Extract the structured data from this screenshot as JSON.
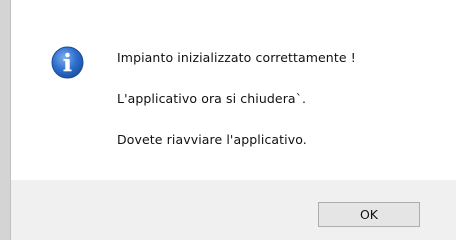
{
  "dialog": {
    "icon": "info-icon",
    "messages": [
      "Impianto inizializzato correttamente !",
      "L'applicativo ora si chiudera`.",
      "Dovete riavviare l'applicativo."
    ],
    "ok_label": "OK"
  },
  "colors": {
    "icon_blue": "#1a5fb4",
    "footer_bg": "#f0f0f0",
    "button_bg": "#e5e5e5",
    "button_border": "#adadad"
  }
}
